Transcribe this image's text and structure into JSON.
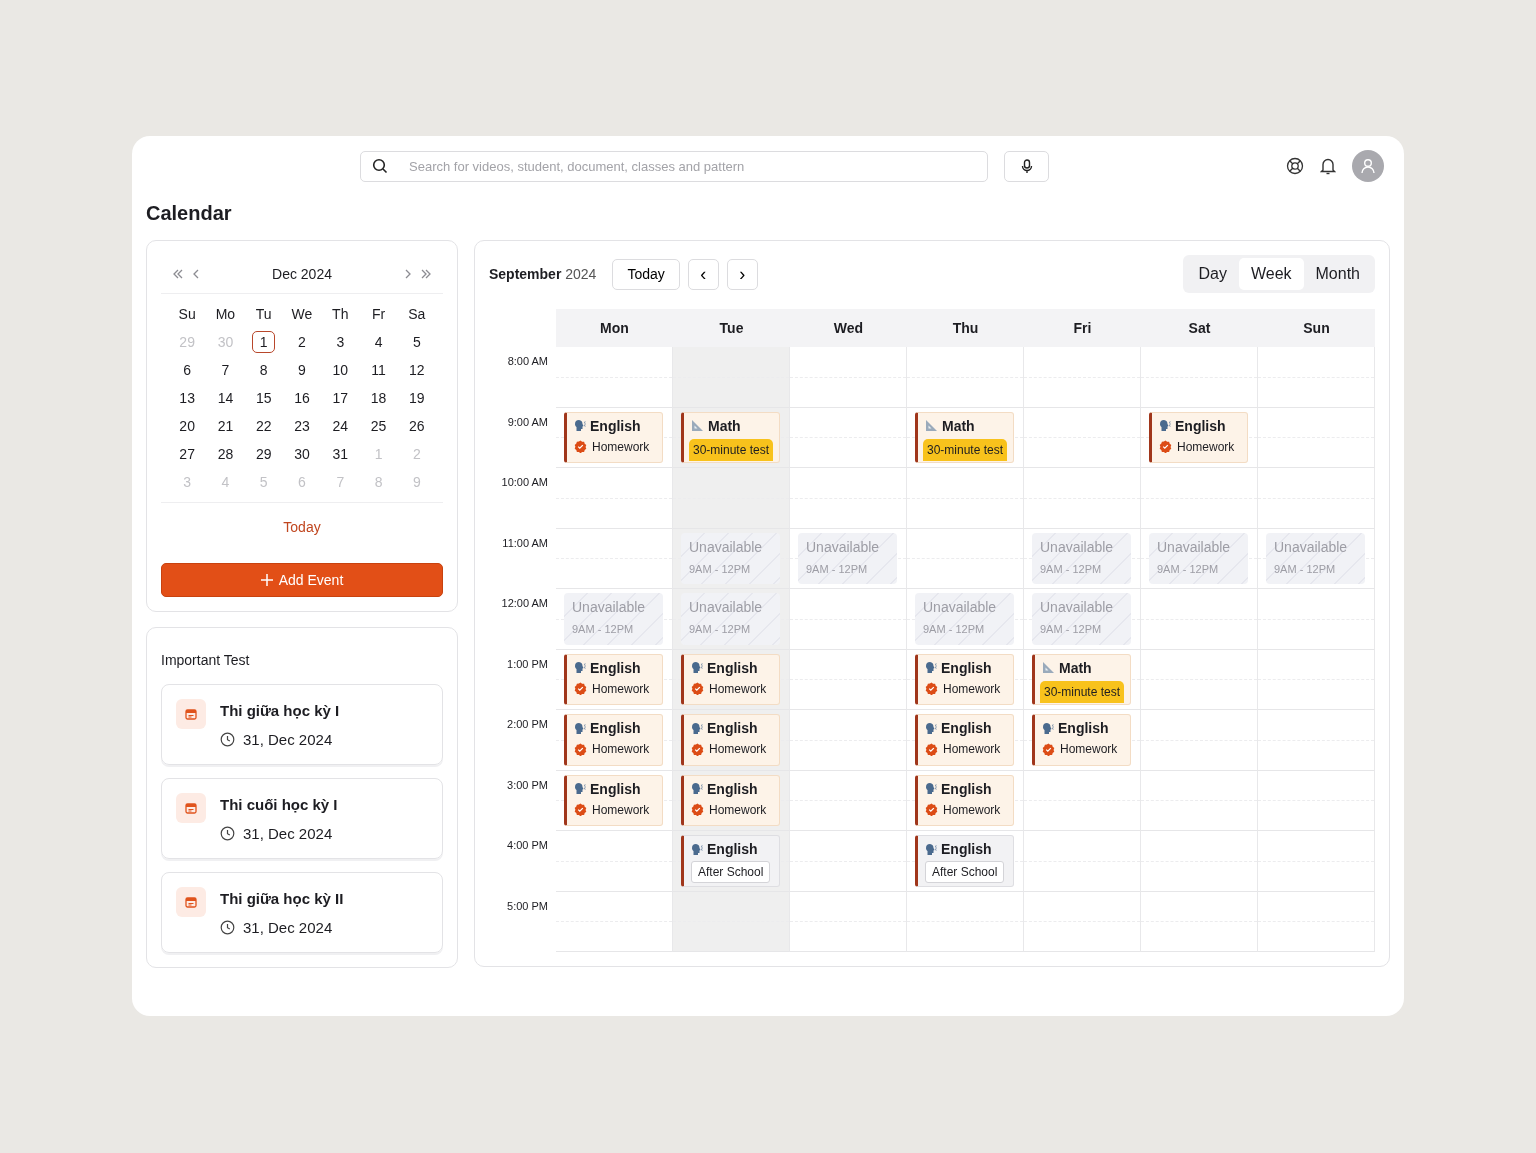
{
  "header": {
    "search": {
      "placeholder": "Search for videos, student, document, classes and pattern"
    }
  },
  "page_title": "Calendar",
  "mini_calendar": {
    "month": "Dec 2024",
    "weekdays": [
      "Su",
      "Mo",
      "Tu",
      "We",
      "Th",
      "Fr",
      "Sa"
    ],
    "weeks": [
      [
        {
          "label": "29",
          "muted": true,
          "selected": false
        },
        {
          "label": "30",
          "muted": true,
          "selected": false
        },
        {
          "label": "1",
          "muted": false,
          "selected": true
        },
        {
          "label": "2",
          "muted": false,
          "selected": false
        },
        {
          "label": "3",
          "muted": false,
          "selected": false
        },
        {
          "label": "4",
          "muted": false,
          "selected": false
        },
        {
          "label": "5",
          "muted": false,
          "selected": false
        }
      ],
      [
        {
          "label": "6",
          "muted": false,
          "selected": false
        },
        {
          "label": "7",
          "muted": false,
          "selected": false
        },
        {
          "label": "8",
          "muted": false,
          "selected": false
        },
        {
          "label": "9",
          "muted": false,
          "selected": false
        },
        {
          "label": "10",
          "muted": false,
          "selected": false
        },
        {
          "label": "11",
          "muted": false,
          "selected": false
        },
        {
          "label": "12",
          "muted": false,
          "selected": false
        }
      ],
      [
        {
          "label": "13",
          "muted": false,
          "selected": false
        },
        {
          "label": "14",
          "muted": false,
          "selected": false
        },
        {
          "label": "15",
          "muted": false,
          "selected": false
        },
        {
          "label": "16",
          "muted": false,
          "selected": false
        },
        {
          "label": "17",
          "muted": false,
          "selected": false
        },
        {
          "label": "18",
          "muted": false,
          "selected": false
        },
        {
          "label": "19",
          "muted": false,
          "selected": false
        }
      ],
      [
        {
          "label": "20",
          "muted": false,
          "selected": false
        },
        {
          "label": "21",
          "muted": false,
          "selected": false
        },
        {
          "label": "22",
          "muted": false,
          "selected": false
        },
        {
          "label": "23",
          "muted": false,
          "selected": false
        },
        {
          "label": "24",
          "muted": false,
          "selected": false
        },
        {
          "label": "25",
          "muted": false,
          "selected": false
        },
        {
          "label": "26",
          "muted": false,
          "selected": false
        }
      ],
      [
        {
          "label": "27",
          "muted": false,
          "selected": false
        },
        {
          "label": "28",
          "muted": false,
          "selected": false
        },
        {
          "label": "29",
          "muted": false,
          "selected": false
        },
        {
          "label": "30",
          "muted": false,
          "selected": false
        },
        {
          "label": "31",
          "muted": false,
          "selected": false
        },
        {
          "label": "1",
          "muted": true,
          "selected": false
        },
        {
          "label": "2",
          "muted": true,
          "selected": false
        }
      ],
      [
        {
          "label": "3",
          "muted": true,
          "selected": false
        },
        {
          "label": "4",
          "muted": true,
          "selected": false
        },
        {
          "label": "5",
          "muted": true,
          "selected": false
        },
        {
          "label": "6",
          "muted": true,
          "selected": false
        },
        {
          "label": "7",
          "muted": true,
          "selected": false
        },
        {
          "label": "8",
          "muted": true,
          "selected": false
        },
        {
          "label": "9",
          "muted": true,
          "selected": false
        }
      ]
    ],
    "today_link": "Today",
    "add_button": "Add Event"
  },
  "important_tests": {
    "title": "Important Test",
    "items": [
      {
        "name": "Thi giữa học kỳ I",
        "date": "31, Dec 2024"
      },
      {
        "name": "Thi cuối học kỳ I",
        "date": "31, Dec 2024"
      },
      {
        "name": "Thi giữa học kỳ II",
        "date": "31, Dec 2024"
      }
    ]
  },
  "schedule": {
    "month": "September",
    "year": "2024",
    "today_button": "Today",
    "prev": "‹",
    "next": "›",
    "views": [
      {
        "label": "Day",
        "selected": false
      },
      {
        "label": "Week",
        "selected": true
      },
      {
        "label": "Month",
        "selected": false
      }
    ],
    "times": [
      "8:00 AM",
      "9:00 AM",
      "10:00 AM",
      "11:00 AM",
      "12:00 AM",
      "1:00 PM",
      "2:00 PM",
      "3:00 PM",
      "4:00 PM",
      "5:00 PM"
    ],
    "days": [
      {
        "label": "Mon",
        "selected": false,
        "slots": [
          {
            "kind": "empty"
          },
          {
            "kind": "homework",
            "subject": "English",
            "tag": "Homework"
          },
          {
            "kind": "empty"
          },
          {
            "kind": "empty"
          },
          {
            "kind": "unavailable",
            "title": "Unavailable",
            "time": "9AM - 12PM"
          },
          {
            "kind": "homework",
            "subject": "English",
            "tag": "Homework"
          },
          {
            "kind": "homework",
            "subject": "English",
            "tag": "Homework"
          },
          {
            "kind": "homework",
            "subject": "English",
            "tag": "Homework"
          },
          {
            "kind": "empty"
          },
          {
            "kind": "empty"
          }
        ]
      },
      {
        "label": "Tue",
        "selected": true,
        "slots": [
          {
            "kind": "empty"
          },
          {
            "kind": "test",
            "subject": "Math",
            "tag": "30-minute test"
          },
          {
            "kind": "empty"
          },
          {
            "kind": "unavailable",
            "title": "Unavailable",
            "time": "9AM - 12PM"
          },
          {
            "kind": "unavailable",
            "title": "Unavailable",
            "time": "9AM - 12PM"
          },
          {
            "kind": "homework",
            "subject": "English",
            "tag": "Homework"
          },
          {
            "kind": "homework",
            "subject": "English",
            "tag": "Homework"
          },
          {
            "kind": "homework",
            "subject": "English",
            "tag": "Homework"
          },
          {
            "kind": "after_school",
            "subject": "English",
            "tag": "After School"
          },
          {
            "kind": "empty"
          }
        ]
      },
      {
        "label": "Wed",
        "selected": false,
        "slots": [
          {
            "kind": "empty"
          },
          {
            "kind": "empty"
          },
          {
            "kind": "empty"
          },
          {
            "kind": "unavailable",
            "title": "Unavailable",
            "time": "9AM - 12PM"
          },
          {
            "kind": "empty"
          },
          {
            "kind": "empty"
          },
          {
            "kind": "empty"
          },
          {
            "kind": "empty"
          },
          {
            "kind": "empty"
          },
          {
            "kind": "empty"
          }
        ]
      },
      {
        "label": "Thu",
        "selected": false,
        "slots": [
          {
            "kind": "empty"
          },
          {
            "kind": "test",
            "subject": "Math",
            "tag": "30-minute test"
          },
          {
            "kind": "empty"
          },
          {
            "kind": "empty"
          },
          {
            "kind": "unavailable",
            "title": "Unavailable",
            "time": "9AM - 12PM"
          },
          {
            "kind": "homework",
            "subject": "English",
            "tag": "Homework"
          },
          {
            "kind": "homework",
            "subject": "English",
            "tag": "Homework"
          },
          {
            "kind": "homework",
            "subject": "English",
            "tag": "Homework"
          },
          {
            "kind": "after_school",
            "subject": "English",
            "tag": "After School"
          },
          {
            "kind": "empty"
          }
        ]
      },
      {
        "label": "Fri",
        "selected": false,
        "slots": [
          {
            "kind": "empty"
          },
          {
            "kind": "empty"
          },
          {
            "kind": "empty"
          },
          {
            "kind": "unavailable",
            "title": "Unavailable",
            "time": "9AM - 12PM"
          },
          {
            "kind": "unavailable",
            "title": "Unavailable",
            "time": "9AM - 12PM"
          },
          {
            "kind": "test",
            "subject": "Math",
            "tag": "30-minute test"
          },
          {
            "kind": "homework",
            "subject": "English",
            "tag": "Homework"
          },
          {
            "kind": "empty"
          },
          {
            "kind": "empty"
          },
          {
            "kind": "empty"
          }
        ]
      },
      {
        "label": "Sat",
        "selected": false,
        "slots": [
          {
            "kind": "empty"
          },
          {
            "kind": "homework",
            "subject": "English",
            "tag": "Homework"
          },
          {
            "kind": "empty"
          },
          {
            "kind": "unavailable",
            "title": "Unavailable",
            "time": "9AM - 12PM"
          },
          {
            "kind": "empty"
          },
          {
            "kind": "empty"
          },
          {
            "kind": "empty"
          },
          {
            "kind": "empty"
          },
          {
            "kind": "empty"
          },
          {
            "kind": "empty"
          }
        ]
      },
      {
        "label": "Sun",
        "selected": false,
        "slots": [
          {
            "kind": "empty"
          },
          {
            "kind": "empty"
          },
          {
            "kind": "empty"
          },
          {
            "kind": "unavailable",
            "title": "Unavailable",
            "time": "9AM - 12PM"
          },
          {
            "kind": "empty"
          },
          {
            "kind": "empty"
          },
          {
            "kind": "empty"
          },
          {
            "kind": "empty"
          },
          {
            "kind": "empty"
          },
          {
            "kind": "empty"
          }
        ]
      }
    ]
  }
}
